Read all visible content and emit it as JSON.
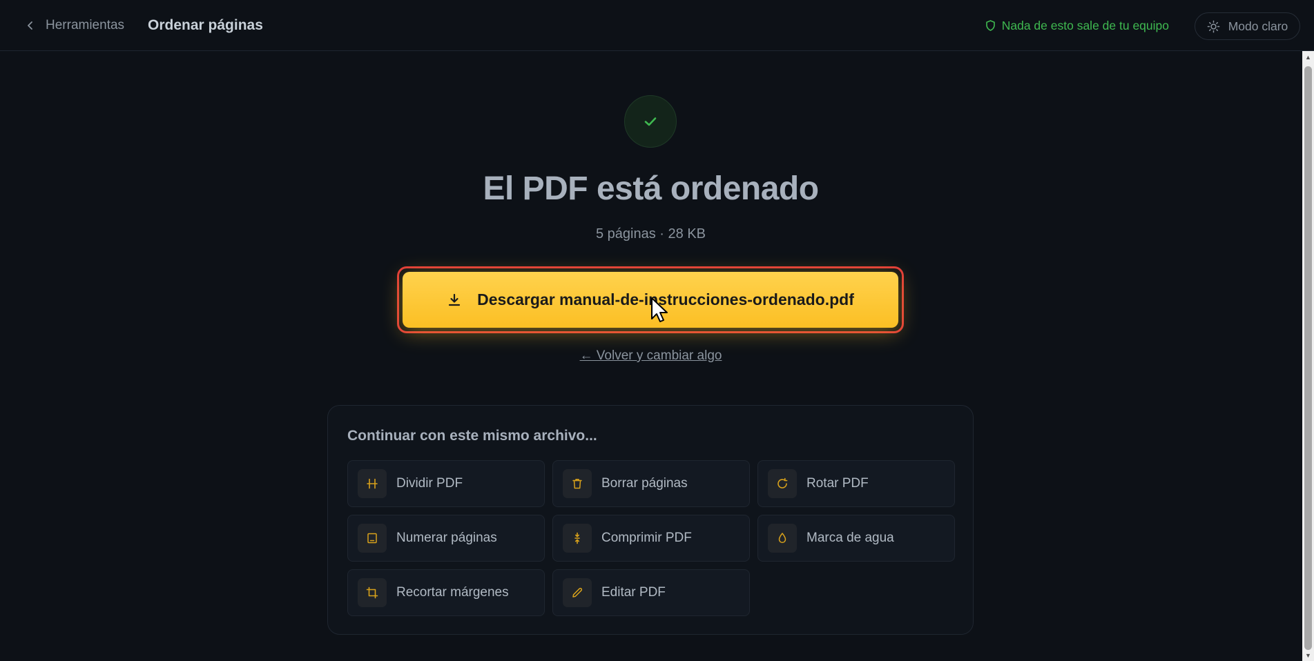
{
  "header": {
    "back_label": "Herramientas",
    "page_title": "Ordenar páginas",
    "privacy_text": "Nada de esto sale de tu equipo",
    "mode_label": "Modo claro"
  },
  "result": {
    "headline": "El PDF está ordenado",
    "meta": "5 páginas · 28 KB",
    "download_label": "Descargar manual-de-instrucciones-ordenado.pdf",
    "back_change_label": "← Volver y cambiar algo"
  },
  "continue": {
    "title": "Continuar con este mismo archivo...",
    "tools": [
      {
        "label": "Dividir PDF",
        "icon": "split-icon"
      },
      {
        "label": "Borrar páginas",
        "icon": "trash-icon"
      },
      {
        "label": "Rotar PDF",
        "icon": "rotate-icon"
      },
      {
        "label": "Numerar páginas",
        "icon": "page-number-icon"
      },
      {
        "label": "Comprimir PDF",
        "icon": "compress-icon"
      },
      {
        "label": "Marca de agua",
        "icon": "droplet-icon"
      },
      {
        "label": "Recortar márgenes",
        "icon": "crop-icon"
      },
      {
        "label": "Editar PDF",
        "icon": "pencil-icon"
      }
    ]
  },
  "colors": {
    "accent": "#fbbf24",
    "success": "#3fb950",
    "highlight_outline": "#e03a3a",
    "background": "#0d1117"
  }
}
